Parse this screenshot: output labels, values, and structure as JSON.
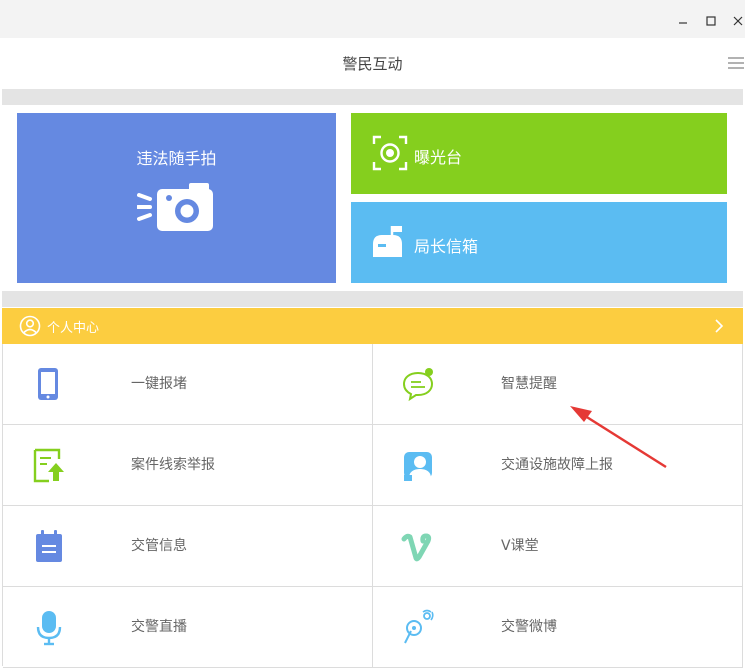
{
  "window": {
    "title": "警民互动",
    "controls": [
      "minimize",
      "maximize",
      "close"
    ]
  },
  "tiles": {
    "main": {
      "label": "违法随手拍",
      "icon": "camera-icon",
      "color": "#6589e1"
    },
    "exposure": {
      "label": "曝光台",
      "icon": "focus-target-icon",
      "color": "#85cf1e"
    },
    "mailbox": {
      "label": "局长信箱",
      "icon": "mailbox-icon",
      "color": "#5bbcf2"
    }
  },
  "personal_center": {
    "label": "个人中心",
    "icon": "user-circle-icon",
    "color": "#fccd40"
  },
  "services": [
    {
      "label": "一键报堵",
      "icon": "phone-icon",
      "icon_color": "#6589e1"
    },
    {
      "label": "智慧提醒",
      "icon": "chat-bubble-icon",
      "icon_color": "#85cf1e"
    },
    {
      "label": "案件线索举报",
      "icon": "report-upload-icon",
      "icon_color": "#85cf1e"
    },
    {
      "label": "交通设施故障上报",
      "icon": "facility-report-icon",
      "icon_color": "#5bbcf2"
    },
    {
      "label": "交管信息",
      "icon": "notepad-icon",
      "icon_color": "#6589e1"
    },
    {
      "label": "V课堂",
      "icon": "vimeo-v-icon",
      "icon_color": "#7fd6b4"
    },
    {
      "label": "交警直播",
      "icon": "microphone-icon",
      "icon_color": "#5bbcf2"
    },
    {
      "label": "交警微博",
      "icon": "weibo-icon",
      "icon_color": "#5bbcf2"
    }
  ],
  "annotation": {
    "icon": "red-arrow-icon",
    "color": "#e53935"
  }
}
